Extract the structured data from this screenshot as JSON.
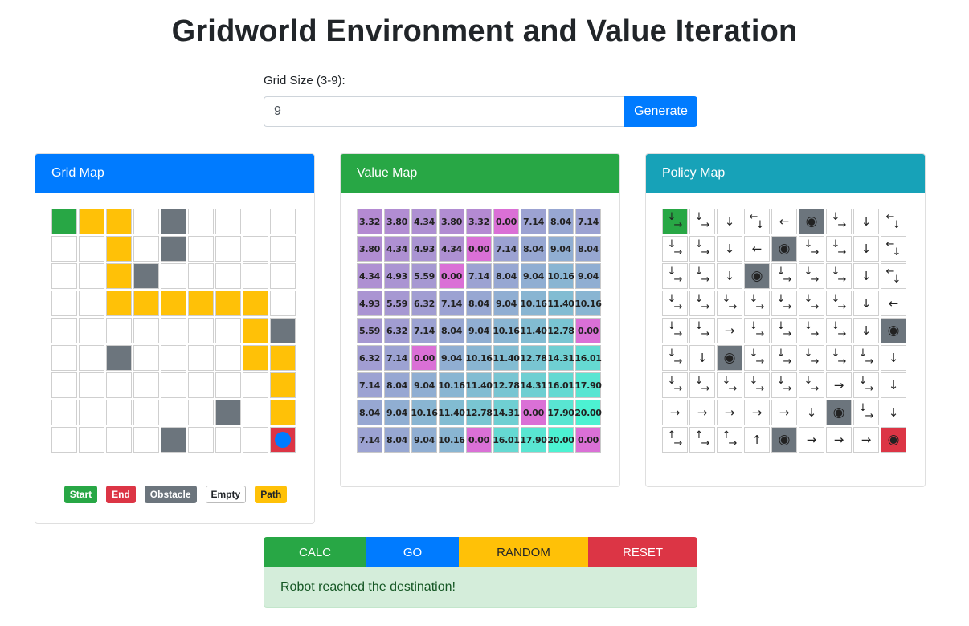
{
  "title": "Gridworld Environment and Value Iteration",
  "size_form": {
    "label": "Grid Size (3-9):",
    "value": "9",
    "button": "Generate"
  },
  "cards": {
    "grid_map": {
      "title": "Grid Map",
      "color": "#007bff"
    },
    "value_map": {
      "title": "Value Map",
      "color": "#28a745"
    },
    "policy_map": {
      "title": "Policy Map",
      "color": "#17a2b8"
    }
  },
  "grid_rows": [
    "SPPEOEEEE",
    "EEPEOEEEE",
    "EEPOEEEEE",
    "EEPPPPPPE",
    "EEEEEEEPO",
    "EEOEEEEPP",
    "EEEEEEEEP",
    "EEEEEEOEP",
    "EEEEOEEEX"
  ],
  "cell_colors": {
    "S": "#28a745",
    "X": "#dc3545",
    "O": "#6c757d",
    "E": "#ffffff",
    "P": "#ffc107"
  },
  "robot_icon": "robot-circle-icon",
  "legend": [
    {
      "label": "Start",
      "color": "#28a745",
      "text": "#ffffff"
    },
    {
      "label": "End",
      "color": "#dc3545",
      "text": "#ffffff"
    },
    {
      "label": "Obstacle",
      "color": "#6c757d",
      "text": "#ffffff"
    },
    {
      "label": "Empty",
      "color": "#ffffff",
      "text": "#212529"
    },
    {
      "label": "Path",
      "color": "#ffc107",
      "text": "#212529"
    }
  ],
  "value_rows": [
    [
      "3.32",
      "3.80",
      "4.34",
      "3.80",
      "3.32",
      "0.00",
      "7.14",
      "8.04",
      "7.14"
    ],
    [
      "3.80",
      "4.34",
      "4.93",
      "4.34",
      "0.00",
      "7.14",
      "8.04",
      "9.04",
      "8.04"
    ],
    [
      "4.34",
      "4.93",
      "5.59",
      "0.00",
      "7.14",
      "8.04",
      "9.04",
      "10.16",
      "9.04"
    ],
    [
      "4.93",
      "5.59",
      "6.32",
      "7.14",
      "8.04",
      "9.04",
      "10.16",
      "11.40",
      "10.16"
    ],
    [
      "5.59",
      "6.32",
      "7.14",
      "8.04",
      "9.04",
      "10.16",
      "11.40",
      "12.78",
      "0.00"
    ],
    [
      "6.32",
      "7.14",
      "0.00",
      "9.04",
      "10.16",
      "11.40",
      "12.78",
      "14.31",
      "16.01"
    ],
    [
      "7.14",
      "8.04",
      "9.04",
      "10.16",
      "11.40",
      "12.78",
      "14.31",
      "16.01",
      "17.90"
    ],
    [
      "8.04",
      "9.04",
      "10.16",
      "11.40",
      "12.78",
      "14.31",
      "0.00",
      "17.90",
      "20.00"
    ],
    [
      "7.14",
      "8.04",
      "9.04",
      "10.16",
      "0.00",
      "16.01",
      "17.90",
      "20.00",
      "0.00"
    ]
  ],
  "value_scale": {
    "min": 3.32,
    "max": 20.0,
    "low_color": "#b48ad2",
    "high_color": "#4cf2d2",
    "zero_color": "#da70d6"
  },
  "policy_rows": [
    [
      "↓→",
      "↓→",
      "↓",
      "←↓",
      "←",
      "◉",
      "↓→",
      "↓",
      "←↓"
    ],
    [
      "↓→",
      "↓→",
      "↓",
      "←",
      "◉",
      "↓→",
      "↓→",
      "↓",
      "←↓"
    ],
    [
      "↓→",
      "↓→",
      "↓",
      "◉",
      "↓→",
      "↓→",
      "↓→",
      "↓",
      "←↓"
    ],
    [
      "↓→",
      "↓→",
      "↓→",
      "↓→",
      "↓→",
      "↓→",
      "↓→",
      "↓",
      "←"
    ],
    [
      "↓→",
      "↓→",
      "→",
      "↓→",
      "↓→",
      "↓→",
      "↓→",
      "↓",
      "◉"
    ],
    [
      "↓→",
      "↓",
      "◉",
      "↓→",
      "↓→",
      "↓→",
      "↓→",
      "↓→",
      "↓"
    ],
    [
      "↓→",
      "↓→",
      "↓→",
      "↓→",
      "↓→",
      "↓→",
      "→",
      "↓→",
      "↓"
    ],
    [
      "→",
      "→",
      "→",
      "→",
      "→",
      "↓",
      "◉",
      "↓→",
      "↓"
    ],
    [
      "↑→",
      "↑→",
      "↑→",
      "↑",
      "◉",
      "→",
      "→",
      "→",
      "◉"
    ]
  ],
  "policy_start": [
    0,
    0
  ],
  "policy_end": [
    8,
    8
  ],
  "actions": [
    {
      "label": "CALC",
      "color": "#28a745",
      "text": "#ffffff",
      "name": "calc-button"
    },
    {
      "label": "GO",
      "color": "#007bff",
      "text": "#ffffff",
      "name": "go-button"
    },
    {
      "label": "RANDOM",
      "color": "#ffc107",
      "text": "#212529",
      "name": "random-button"
    },
    {
      "label": "RESET",
      "color": "#dc3545",
      "text": "#ffffff",
      "name": "reset-button"
    }
  ],
  "status": "Robot reached the destination!"
}
